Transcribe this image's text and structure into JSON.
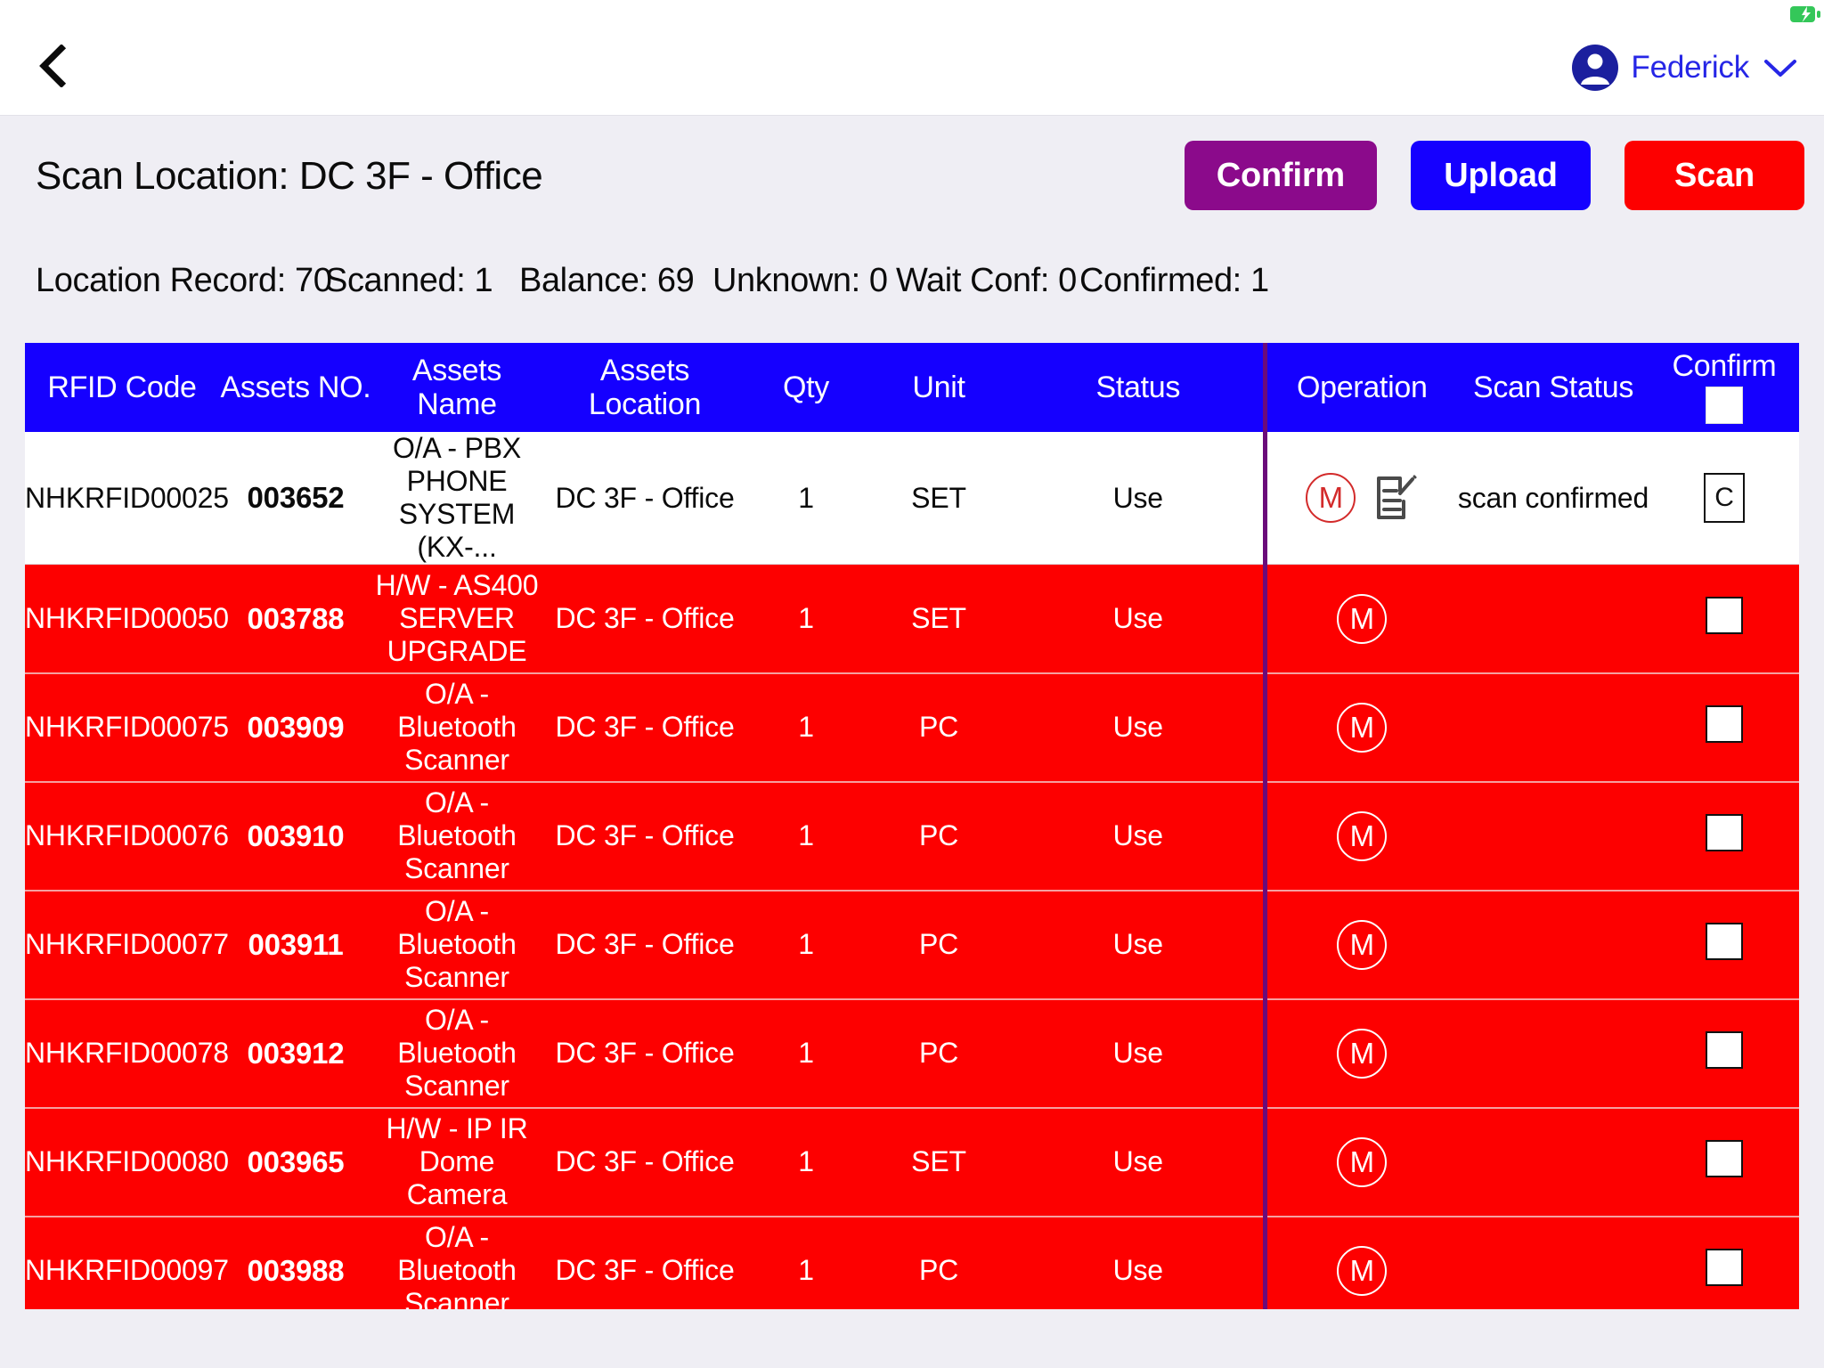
{
  "navbar": {
    "back_icon": "chevron-left-icon",
    "battery_icon": "battery-charging-icon",
    "user_name": "Federick",
    "avatar_icon": "user-avatar-icon",
    "dropdown_icon": "chevron-down-icon"
  },
  "header": {
    "title": "Scan Location: DC 3F - Office",
    "buttons": {
      "confirm": "Confirm",
      "upload": "Upload",
      "scan": "Scan"
    },
    "stats": [
      "Location Record: 70",
      "Scanned: 1",
      "Balance: 69",
      "Unknown: 0",
      "Wait Conf: 0",
      "Confirmed: 1"
    ]
  },
  "table": {
    "columns": [
      "RFID Code",
      "Assets NO.",
      "Assets Name",
      "Assets Location",
      "Qty",
      "Unit",
      "Status",
      "Operation",
      "Scan Status",
      "Confirm"
    ],
    "rows": [
      {
        "rfid": "NHKRFID00025",
        "assets_no": "003652",
        "assets_name": "O/A - PBX PHONE SYSTEM (KX-...",
        "assets_location": "DC 3F - Office",
        "qty": "1",
        "unit": "SET",
        "status": "Use",
        "operation_badge": "M",
        "has_edit_icon": true,
        "scan_status": "scan confirmed",
        "confirm_mark": "C",
        "highlight": "white"
      },
      {
        "rfid": "NHKRFID00050",
        "assets_no": "003788",
        "assets_name": "H/W - AS400 SERVER UPGRADE",
        "assets_location": "DC 3F - Office",
        "qty": "1",
        "unit": "SET",
        "status": "Use",
        "operation_badge": "M",
        "has_edit_icon": false,
        "scan_status": "",
        "confirm_mark": "",
        "highlight": "red"
      },
      {
        "rfid": "NHKRFID00075",
        "assets_no": "003909",
        "assets_name": "O/A - Bluetooth Scanner",
        "assets_location": "DC 3F - Office",
        "qty": "1",
        "unit": "PC",
        "status": "Use",
        "operation_badge": "M",
        "has_edit_icon": false,
        "scan_status": "",
        "confirm_mark": "",
        "highlight": "red"
      },
      {
        "rfid": "NHKRFID00076",
        "assets_no": "003910",
        "assets_name": "O/A - Bluetooth Scanner",
        "assets_location": "DC 3F - Office",
        "qty": "1",
        "unit": "PC",
        "status": "Use",
        "operation_badge": "M",
        "has_edit_icon": false,
        "scan_status": "",
        "confirm_mark": "",
        "highlight": "red"
      },
      {
        "rfid": "NHKRFID00077",
        "assets_no": "003911",
        "assets_name": "O/A - Bluetooth Scanner",
        "assets_location": "DC 3F - Office",
        "qty": "1",
        "unit": "PC",
        "status": "Use",
        "operation_badge": "M",
        "has_edit_icon": false,
        "scan_status": "",
        "confirm_mark": "",
        "highlight": "red"
      },
      {
        "rfid": "NHKRFID00078",
        "assets_no": "003912",
        "assets_name": "O/A - Bluetooth Scanner",
        "assets_location": "DC 3F - Office",
        "qty": "1",
        "unit": "PC",
        "status": "Use",
        "operation_badge": "M",
        "has_edit_icon": false,
        "scan_status": "",
        "confirm_mark": "",
        "highlight": "red"
      },
      {
        "rfid": "NHKRFID00080",
        "assets_no": "003965",
        "assets_name": "H/W - IP IR Dome Camera",
        "assets_location": "DC 3F - Office",
        "qty": "1",
        "unit": "SET",
        "status": "Use",
        "operation_badge": "M",
        "has_edit_icon": false,
        "scan_status": "",
        "confirm_mark": "",
        "highlight": "red"
      },
      {
        "rfid": "NHKRFID00097",
        "assets_no": "003988",
        "assets_name": "O/A - Bluetooth Scanner",
        "assets_location": "DC 3F - Office",
        "qty": "1",
        "unit": "PC",
        "status": "Use",
        "operation_badge": "M",
        "has_edit_icon": false,
        "scan_status": "",
        "confirm_mark": "",
        "highlight": "red"
      }
    ]
  },
  "colors": {
    "header_blue": "#1500ff",
    "row_red": "#fd0000",
    "confirm_purple": "#8b0a8b",
    "upload_blue": "#1500ff",
    "scan_red": "#fd0000",
    "page_bg": "#efeef4",
    "brand_indigo": "#1b1f9e",
    "link_blue": "#2626e6",
    "divider_purple": "#6b0b7a",
    "battery_green": "#34c759"
  }
}
